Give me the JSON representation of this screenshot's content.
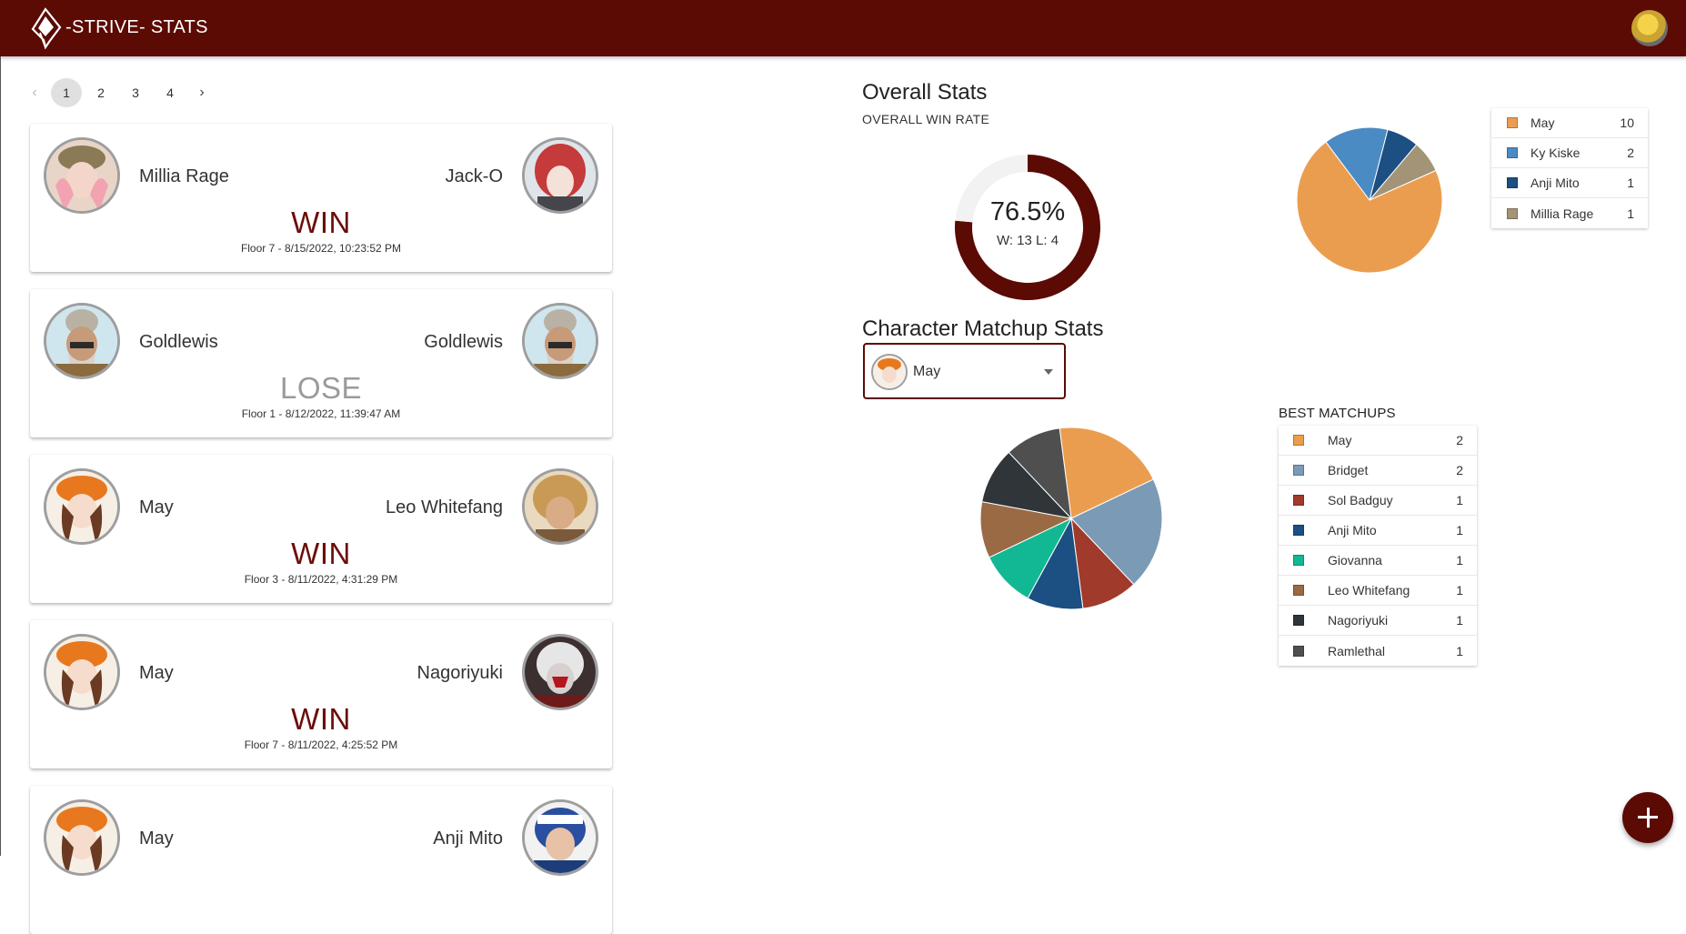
{
  "app": {
    "title": "-STRIVE- STATS",
    "accent_color": "#5b0a04",
    "logo_icon": "strive-logo-icon",
    "user_avatar_icon": "user-avatar-icon"
  },
  "pagination": {
    "prev_icon": "chevron-left-icon",
    "next_icon": "chevron-right-icon",
    "pages": [
      "1",
      "2",
      "3",
      "4"
    ],
    "current": "1"
  },
  "matches": [
    {
      "p1": "Millia Rage",
      "p2": "Jack-O",
      "result": "WIN",
      "meta": "Floor 7 - 8/15/2022, 10:23:52 PM"
    },
    {
      "p1": "Goldlewis",
      "p2": "Goldlewis",
      "result": "LOSE",
      "meta": "Floor 1 - 8/12/2022, 11:39:47 AM"
    },
    {
      "p1": "May",
      "p2": "Leo Whitefang",
      "result": "WIN",
      "meta": "Floor 3 - 8/11/2022, 4:31:29 PM"
    },
    {
      "p1": "May",
      "p2": "Nagoriyuki",
      "result": "WIN",
      "meta": "Floor 7 - 8/11/2022, 4:25:52 PM"
    },
    {
      "p1": "May",
      "p2": "Anji Mito",
      "result": "",
      "meta": ""
    }
  ],
  "overall": {
    "heading": "Overall Stats",
    "subheading": "OVERALL WIN RATE",
    "win_rate_text": "76.5%",
    "wl_text": "W: 13 L: 4"
  },
  "matchup": {
    "heading": "Character Matchup Stats",
    "selected": "May",
    "dropdown_icon": "caret-down-icon",
    "best_title": "BEST MATCHUPS"
  },
  "chart_data": [
    {
      "type": "pie",
      "title": "",
      "values": [
        13,
        4
      ],
      "categories": [
        "W",
        "L"
      ],
      "colors": [
        "#5b0a04",
        "#f2f2f2"
      ]
    },
    {
      "type": "pie",
      "title": "",
      "categories": [
        "May",
        "Ky Kiske",
        "Anji Mito",
        "Millia Rage"
      ],
      "values": [
        10,
        2,
        1,
        1
      ],
      "colors": [
        "#eb9d4f",
        "#4b8bc4",
        "#1c4f82",
        "#a39477"
      ]
    },
    {
      "type": "pie",
      "title": "BEST MATCHUPS",
      "categories": [
        "May",
        "Bridget",
        "Sol Badguy",
        "Anji Mito",
        "Giovanna",
        "Leo Whitefang",
        "Nagoriyuki",
        "Ramlethal"
      ],
      "values": [
        2,
        2,
        1,
        1,
        1,
        1,
        1,
        1
      ],
      "colors": [
        "#eb9d4f",
        "#7b9ab6",
        "#a03a2a",
        "#1c4f82",
        "#12b894",
        "#9a6a45",
        "#2f3538",
        "#4f4f4f"
      ]
    }
  ],
  "fab": {
    "icon": "plus-icon"
  }
}
